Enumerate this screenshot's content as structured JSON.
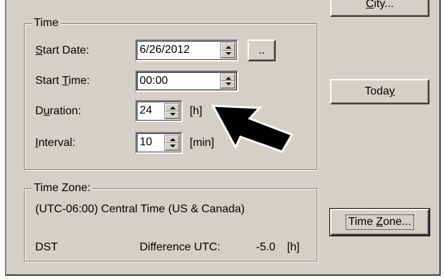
{
  "time_group": {
    "legend": "Time",
    "start_date": {
      "label_pre": "",
      "label_key": "S",
      "label_post": "tart Date:",
      "value": "6/26/2012",
      "picker_label": ".."
    },
    "start_time": {
      "label_pre": "Start ",
      "label_key": "T",
      "label_post": "ime:",
      "value": "00:00"
    },
    "duration": {
      "label_pre": "D",
      "label_key": "u",
      "label_post": "ration:",
      "value": "24",
      "unit": "[h]"
    },
    "interval": {
      "label_pre": "",
      "label_key": "I",
      "label_post": "nterval:",
      "value": "10",
      "unit": "[min]"
    }
  },
  "timezone_group": {
    "legend": "Time Zone:",
    "zone_name": "(UTC-06:00) Central Time (US & Canada)",
    "dst_label": "DST",
    "difference_label": "Difference UTC:",
    "difference_value": "-5.0",
    "difference_unit": "[h]"
  },
  "buttons": {
    "city": {
      "pre": "",
      "key": "C",
      "post": "ity..."
    },
    "today": {
      "pre": "Toda",
      "key": "y",
      "post": ""
    },
    "timezone": {
      "pre": "Time ",
      "key": "Z",
      "post": "one..."
    }
  },
  "colors": {
    "dialog_bg": "#d4d0c8",
    "arrow_fill": "#000000"
  }
}
